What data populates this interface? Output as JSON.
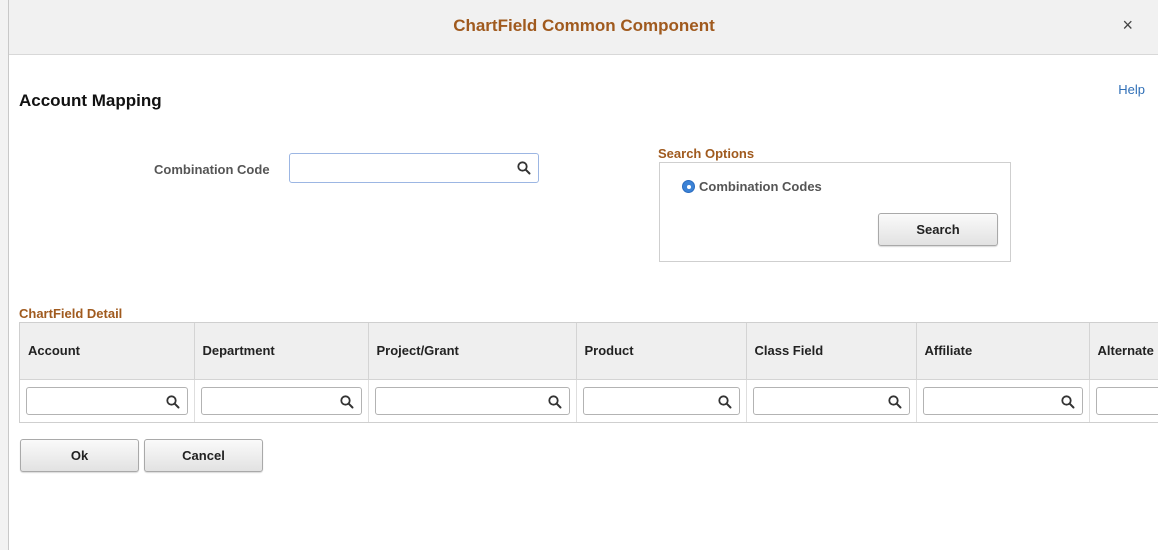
{
  "dialog": {
    "title": "ChartField Common Component",
    "close_glyph": "×",
    "help_label": "Help"
  },
  "page": {
    "title": "Account Mapping"
  },
  "combination_code": {
    "label": "Combination Code",
    "value": ""
  },
  "search_options": {
    "heading": "Search Options",
    "radio_label": "Combination Codes",
    "radio_selected": true,
    "search_button": "Search"
  },
  "chartfield_detail": {
    "heading": "ChartField Detail",
    "columns": [
      "Account",
      "Department",
      "Project/Grant",
      "Product",
      "Class Field",
      "Affiliate",
      "Alternate"
    ],
    "row_values": [
      "",
      "",
      "",
      "",
      "",
      "",
      ""
    ]
  },
  "actions": {
    "ok_label": "Ok",
    "cancel_label": "Cancel"
  },
  "colors": {
    "accent": "#a05a1e",
    "link": "#2f6fb7",
    "radio": "#3b82d6"
  },
  "icons": {
    "lookup": "search-icon",
    "close": "close-icon"
  }
}
